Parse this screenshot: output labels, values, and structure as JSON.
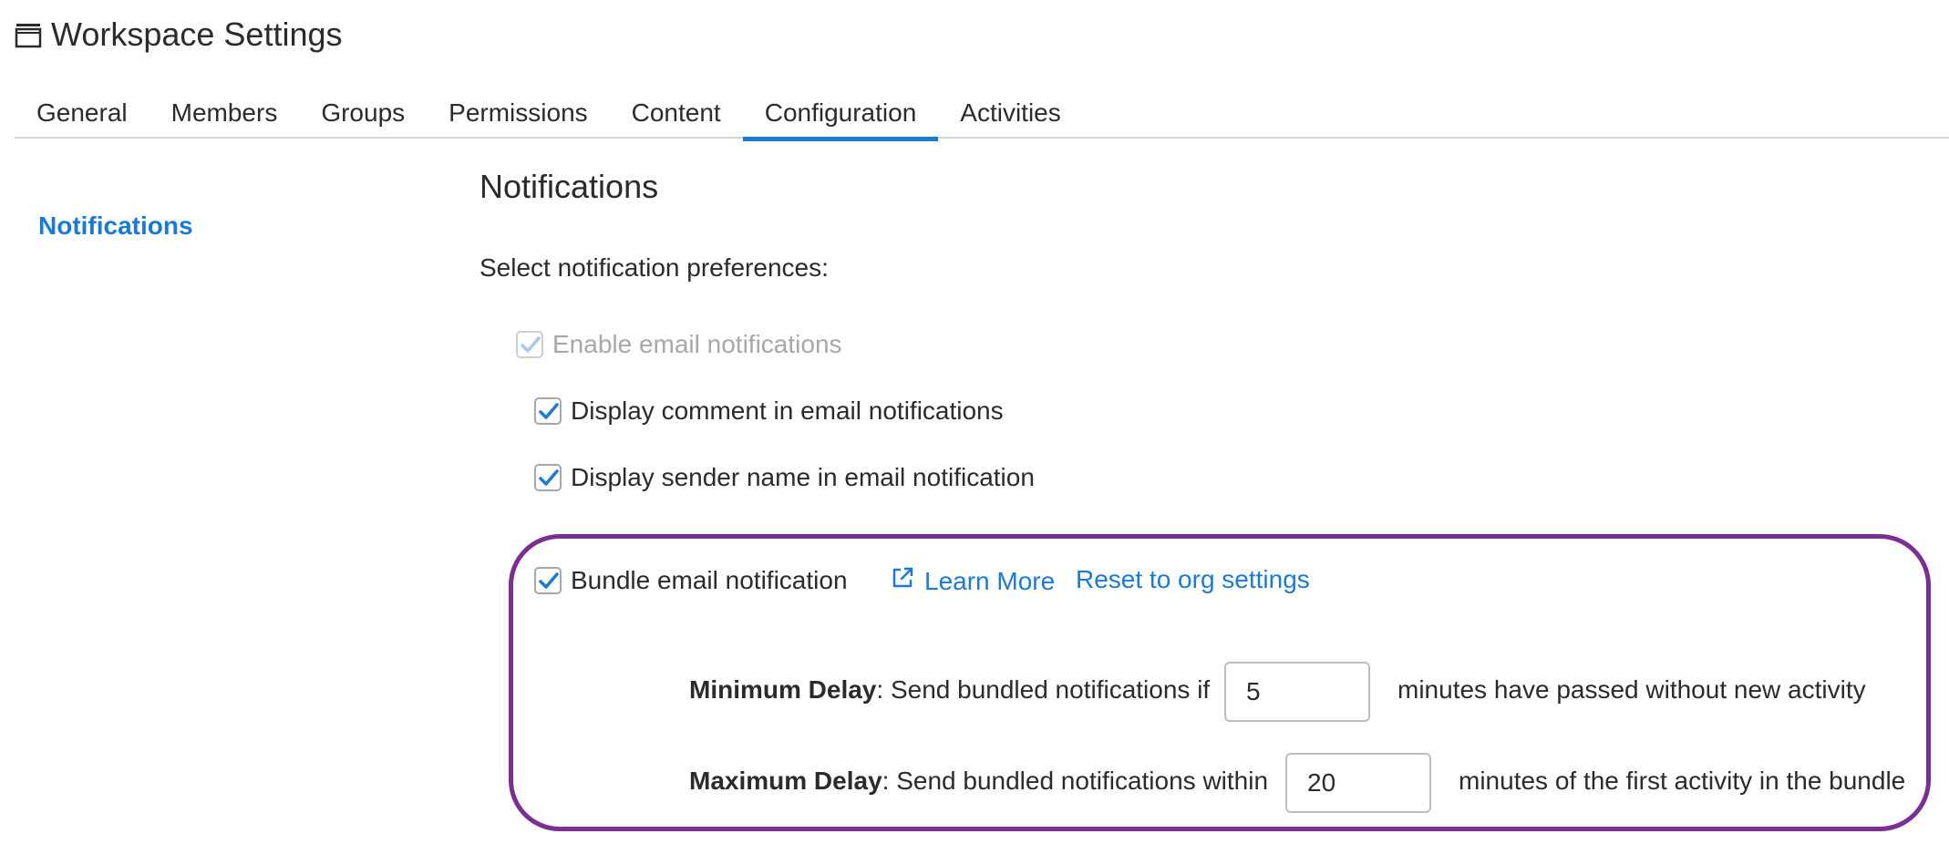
{
  "header": {
    "icon": "window-icon",
    "title": "Workspace Settings"
  },
  "tabs": [
    {
      "label": "General",
      "active": false
    },
    {
      "label": "Members",
      "active": false
    },
    {
      "label": "Groups",
      "active": false
    },
    {
      "label": "Permissions",
      "active": false
    },
    {
      "label": "Content",
      "active": false
    },
    {
      "label": "Configuration",
      "active": true
    },
    {
      "label": "Activities",
      "active": false
    }
  ],
  "sidebar": {
    "items": [
      {
        "label": "Notifications",
        "active": true
      }
    ]
  },
  "notifications": {
    "title": "Notifications",
    "subtitle": "Select notification preferences:",
    "options": [
      {
        "label": "Enable email notifications",
        "checked": true,
        "disabled": true
      },
      {
        "label": "Display comment in email notifications",
        "checked": true,
        "disabled": false
      },
      {
        "label": "Display sender name in email notification",
        "checked": true,
        "disabled": false
      }
    ],
    "bundle": {
      "label": "Bundle email notification",
      "checked": true,
      "learn_more": "Learn More",
      "reset": "Reset to org settings",
      "min_delay": {
        "label": "Minimum Delay",
        "prefix": ": Send bundled notifications if",
        "value": "5",
        "suffix": "minutes have passed without new activity"
      },
      "max_delay": {
        "label": "Maximum Delay",
        "prefix": ": Send bundled notifications within",
        "value": "20",
        "suffix": "minutes of the first activity in the bundle"
      }
    }
  },
  "colors": {
    "accent": "#1b7bd4",
    "highlight": "#7b2e94",
    "disabled": "#a8a8a8"
  }
}
